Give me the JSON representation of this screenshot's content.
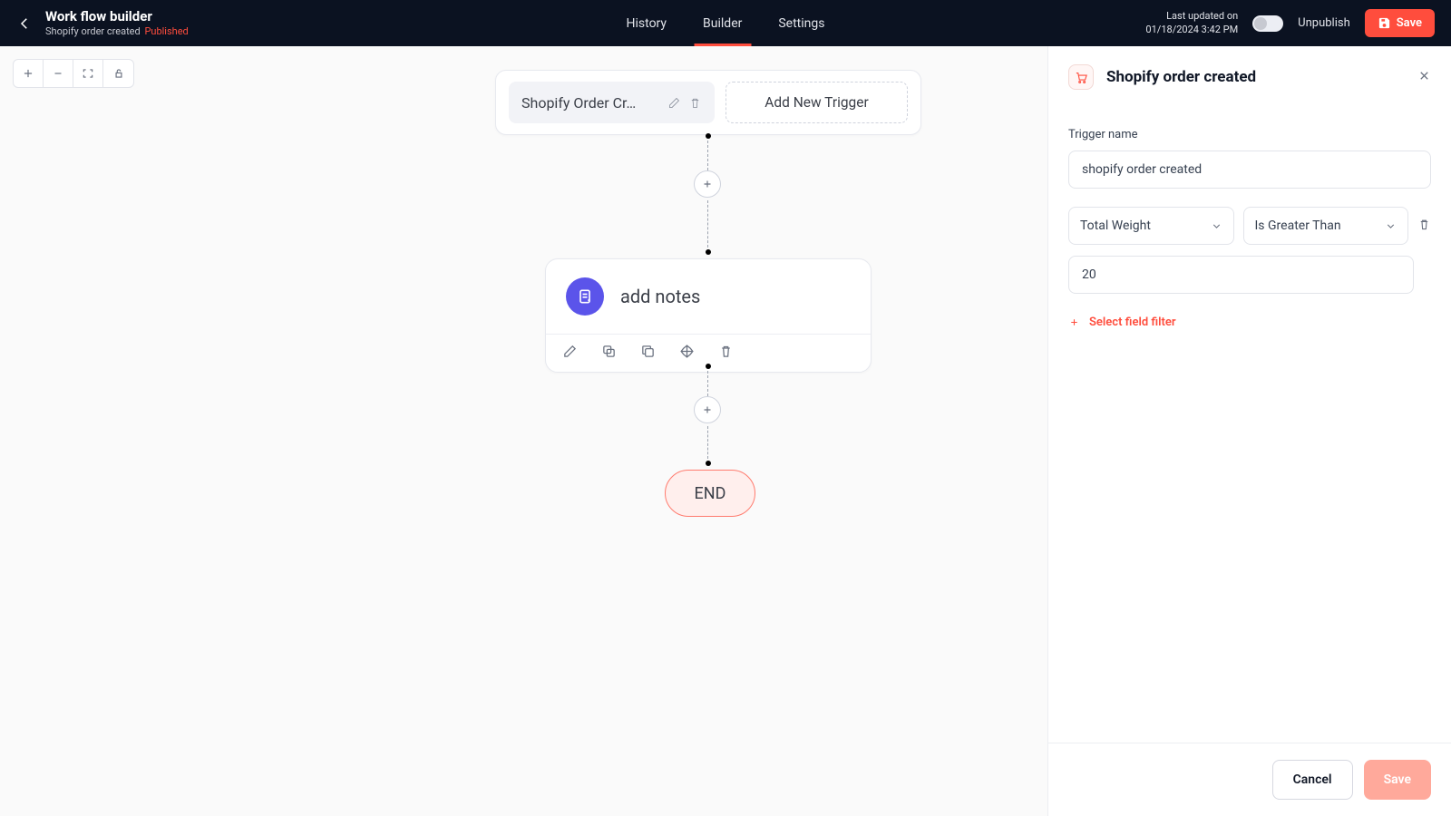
{
  "header": {
    "title": "Work flow builder",
    "subtitle": "Shopify order created",
    "status": "Published",
    "tabs": [
      "History",
      "Builder",
      "Settings"
    ],
    "active_tab": "Builder",
    "updated_label": "Last updated on",
    "updated_value": "01/18/2024 3:42 PM",
    "unpublish": "Unpublish",
    "save": "Save"
  },
  "canvas": {
    "trigger": {
      "label": "Shopify Order Cr…"
    },
    "add_trigger": "Add New Trigger",
    "action": {
      "label": "add notes"
    },
    "end": "END"
  },
  "panel": {
    "title": "Shopify order created",
    "trigger_name_label": "Trigger name",
    "trigger_name_value": "shopify order created",
    "condition": {
      "field": "Total Weight",
      "operator": "Is Greater Than",
      "value": "20"
    },
    "add_filter": "Select field filter",
    "cancel": "Cancel",
    "save": "Save"
  }
}
